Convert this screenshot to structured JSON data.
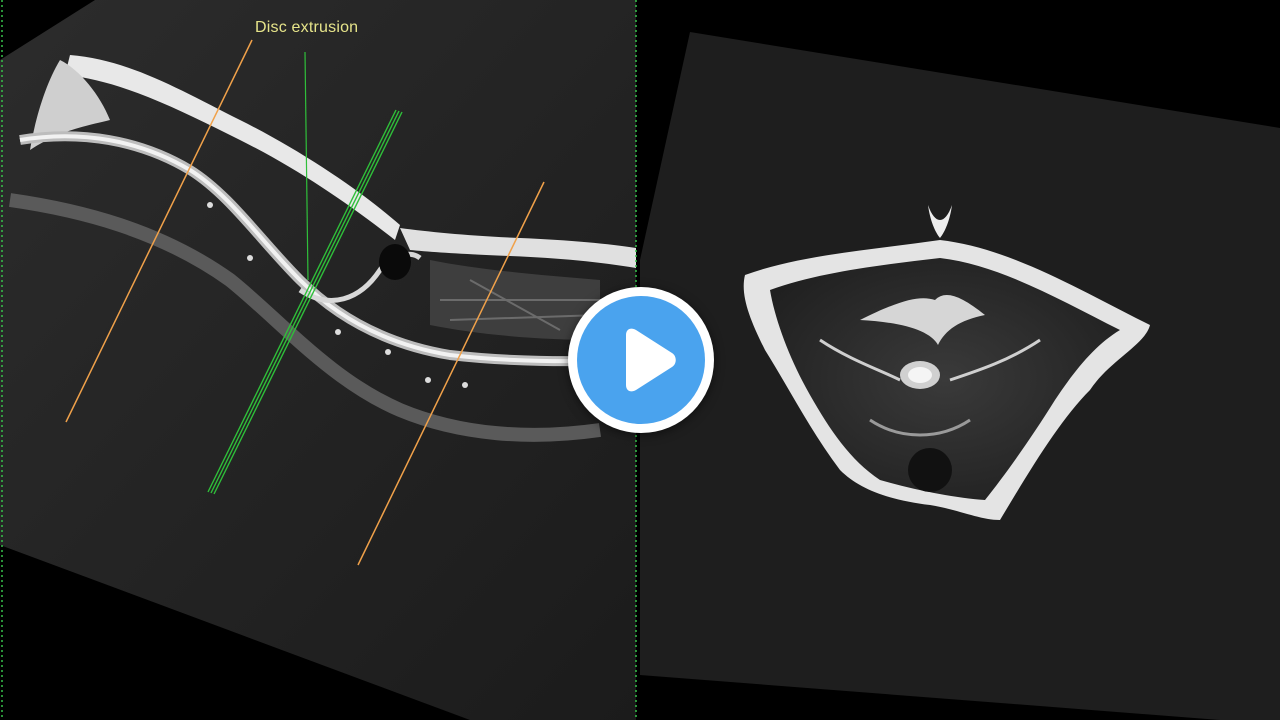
{
  "annotation": {
    "label": "Disc extrusion"
  },
  "colors": {
    "background": "#000000",
    "annotation_text": "#e6e48a",
    "orange_line": "#f0a14a",
    "green_line": "#2fbf3a",
    "divider": "#37c24a",
    "play_button": "#4aa3ee"
  },
  "player": {
    "play_icon": "play-icon"
  }
}
